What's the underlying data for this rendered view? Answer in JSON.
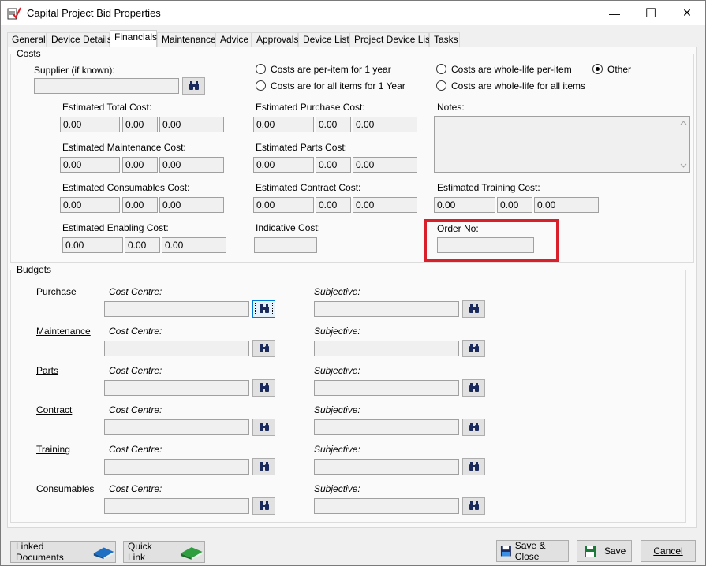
{
  "window": {
    "title": "Capital Project Bid Properties",
    "min": "—",
    "max": "☐",
    "close": "✕"
  },
  "tabs": [
    {
      "label": "General"
    },
    {
      "label": "Device Details"
    },
    {
      "label": "Financials"
    },
    {
      "label": "Maintenance"
    },
    {
      "label": "Advice"
    },
    {
      "label": "Approvals"
    },
    {
      "label": "Device List"
    },
    {
      "label": "Project Device List"
    },
    {
      "label": "Tasks"
    }
  ],
  "active_tab": "Financials",
  "costs": {
    "group_label": "Costs",
    "supplier_label": "Supplier (if known):",
    "supplier_value": "",
    "radios": {
      "per_item_1yr": "Costs are per-item for 1 year",
      "all_items_1yr": "Costs are for all items for 1 Year",
      "whole_life_per_item": "Costs are whole-life per-item",
      "whole_life_all": "Costs are whole-life for all items",
      "other": "Other",
      "selected": "Other"
    },
    "est_total": {
      "label": "Estimated Total Cost:",
      "v1": "0.00",
      "v2": "0.00",
      "v3": "0.00"
    },
    "est_purchase": {
      "label": "Estimated Purchase Cost:",
      "v1": "0.00",
      "v2": "0.00",
      "v3": "0.00"
    },
    "est_maintenance": {
      "label": "Estimated Maintenance Cost:",
      "v1": "0.00",
      "v2": "0.00",
      "v3": "0.00"
    },
    "est_parts": {
      "label": "Estimated Parts Cost:",
      "v1": "0.00",
      "v2": "0.00",
      "v3": "0.00"
    },
    "est_consumables": {
      "label": "Estimated Consumables Cost:",
      "v1": "0.00",
      "v2": "0.00",
      "v3": "0.00"
    },
    "est_contract": {
      "label": "Estimated Contract Cost:",
      "v1": "0.00",
      "v2": "0.00",
      "v3": "0.00"
    },
    "est_training": {
      "label": "Estimated Training Cost:",
      "v1": "0.00",
      "v2": "0.00",
      "v3": "0.00"
    },
    "est_enabling": {
      "label": "Estimated Enabling Cost:",
      "v1": "0.00",
      "v2": "0.00",
      "v3": "0.00"
    },
    "notes_label": "Notes:",
    "notes_value": "",
    "indicative_label": "Indicative Cost:",
    "indicative_value": "",
    "order_no_label": "Order No:",
    "order_no_value": ""
  },
  "budgets": {
    "group_label": "Budgets",
    "cost_centre_label": "Cost Centre:",
    "subjective_label": "Subjective:",
    "rows": [
      {
        "label": "Purchase",
        "cost_centre": "",
        "subjective": ""
      },
      {
        "label": "Maintenance",
        "cost_centre": "",
        "subjective": ""
      },
      {
        "label": "Parts",
        "cost_centre": "",
        "subjective": ""
      },
      {
        "label": "Contract",
        "cost_centre": "",
        "subjective": ""
      },
      {
        "label": "Training",
        "cost_centre": "",
        "subjective": ""
      },
      {
        "label": "Consumables",
        "cost_centre": "",
        "subjective": ""
      }
    ]
  },
  "footer": {
    "linked_documents": "Linked Documents",
    "quick_link": "Quick Link",
    "save_close": "Save & Close",
    "save": "Save",
    "cancel": "Cancel"
  },
  "colors": {
    "highlight_box": "#d9202a",
    "linked_docs_icon": "#1e6fc4",
    "quick_link_icon": "#2e9e3e"
  }
}
